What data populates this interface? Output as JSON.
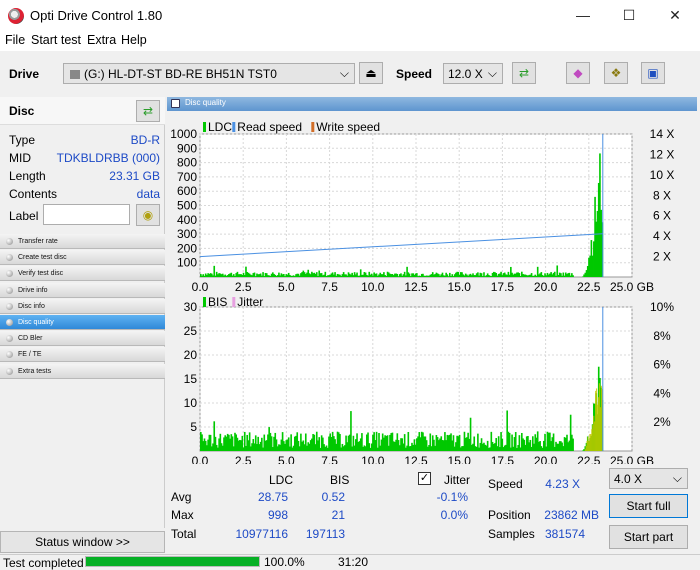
{
  "window": {
    "title": "Opti Drive Control 1.80",
    "minimize": "—",
    "maximize": "☐",
    "close": "✕"
  },
  "menu": [
    "File",
    "Start test",
    "Extra",
    "Help"
  ],
  "toolbar": {
    "drive_label": "Drive",
    "drive_value": "(G:)   HL-DT-ST BD-RE  BH51N TST0",
    "speed_label": "Speed",
    "speed_value": "12.0 X"
  },
  "disc": {
    "header": "Disc",
    "fields": [
      {
        "key": "Type",
        "value": "BD-R"
      },
      {
        "key": "MID",
        "value": "TDKBLDRBB (000)"
      },
      {
        "key": "Length",
        "value": "23.31 GB"
      },
      {
        "key": "Contents",
        "value": "data"
      }
    ],
    "label_key": "Label",
    "label_value": ""
  },
  "nav": [
    {
      "label": "Transfer rate",
      "active": false
    },
    {
      "label": "Create test disc",
      "active": false
    },
    {
      "label": "Verify test disc",
      "active": false
    },
    {
      "label": "Drive info",
      "active": false
    },
    {
      "label": "Disc info",
      "active": false
    },
    {
      "label": "Disc quality",
      "active": true
    },
    {
      "label": "CD Bler",
      "active": false
    },
    {
      "label": "FE / TE",
      "active": false
    },
    {
      "label": "Extra tests",
      "active": false
    }
  ],
  "status_window_label": "Status window >>",
  "panel_title": "Disc quality",
  "chart_data": [
    {
      "type": "area",
      "legend": [
        "LDC",
        "Read speed",
        "Write speed"
      ],
      "colors": {
        "LDC": "#00c800",
        "Read speed": "#4a90e2",
        "Write speed": "#d26e28"
      },
      "x_ticks": [
        "0.0",
        "2.5",
        "5.0",
        "7.5",
        "10.0",
        "12.5",
        "15.0",
        "17.5",
        "20.0",
        "22.5",
        "25.0 GB"
      ],
      "xlim": [
        0,
        25
      ],
      "y_ticks": [
        "100",
        "200",
        "300",
        "400",
        "500",
        "600",
        "700",
        "800",
        "900",
        "1000"
      ],
      "ylim": [
        0,
        1000
      ],
      "y2_ticks": [
        "2 X",
        "4 X",
        "6 X",
        "8 X",
        "10 X",
        "12 X",
        "14 X"
      ],
      "y2lim": [
        0,
        14
      ],
      "ldc_baseline": 28.75,
      "ldc_peak": {
        "x": 23.2,
        "y": 998
      },
      "read_speed": {
        "x": [
          0,
          23.3
        ],
        "y": [
          2.0,
          4.23
        ]
      },
      "data_end_gb": 23.31
    },
    {
      "type": "area",
      "legend": [
        "BIS",
        "Jitter"
      ],
      "colors": {
        "BIS": "#00c800",
        "Jitter": "#e7a0e0"
      },
      "x_ticks": [
        "0.0",
        "2.5",
        "5.0",
        "7.5",
        "10.0",
        "12.5",
        "15.0",
        "17.5",
        "20.0",
        "22.5",
        "25.0 GB"
      ],
      "xlim": [
        0,
        25
      ],
      "y_ticks": [
        "5",
        "10",
        "15",
        "20",
        "25",
        "30"
      ],
      "ylim": [
        0,
        30
      ],
      "y2_ticks": [
        "2%",
        "4%",
        "6%",
        "8%",
        "10%"
      ],
      "y2lim": [
        0,
        10
      ],
      "bis_baseline": 0.52,
      "bis_peak": {
        "x": 23.2,
        "y": 21
      },
      "data_end_gb": 23.31
    }
  ],
  "stats": {
    "col_ldc": "LDC",
    "col_bis": "BIS",
    "jitter_label": "Jitter",
    "jitter_checked": "✓",
    "rows": [
      {
        "label": "Avg",
        "ldc": "28.75",
        "bis": "0.52",
        "jitter": "-0.1%"
      },
      {
        "label": "Max",
        "ldc": "998",
        "bis": "21",
        "jitter": "0.0%"
      },
      {
        "label": "Total",
        "ldc": "10977116",
        "bis": "197113",
        "jitter": ""
      }
    ],
    "speed_label": "Speed",
    "speed_value": "4.23 X",
    "position_label": "Position",
    "position_value": "23862 MB",
    "samples_label": "Samples",
    "samples_value": "381574",
    "test_speed": "4.0 X",
    "start_full": "Start full",
    "start_part": "Start part"
  },
  "status": {
    "text": "Test completed",
    "progress": 100.0,
    "progress_text": "100.0%",
    "time": "31:20"
  }
}
